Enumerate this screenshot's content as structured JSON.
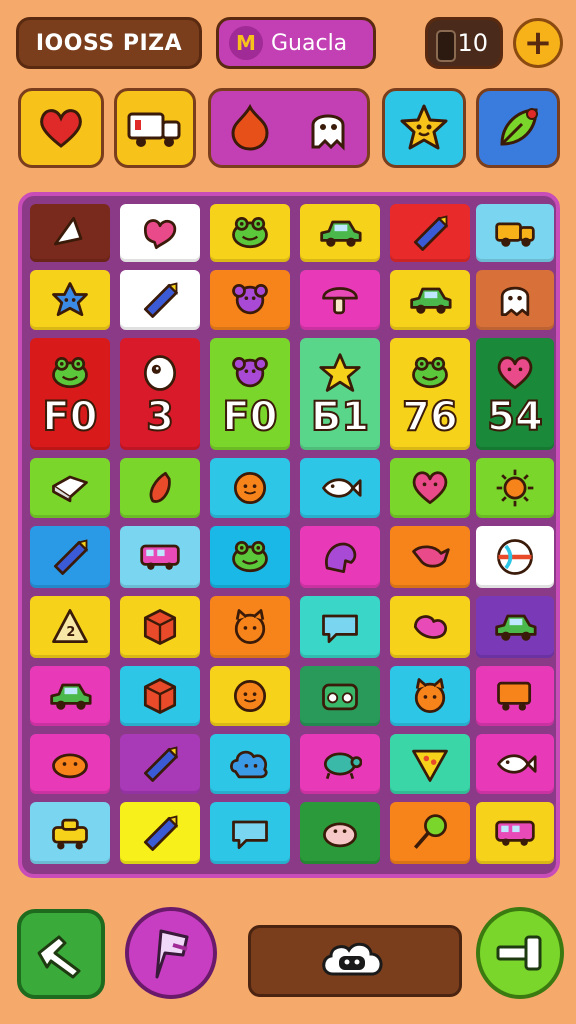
{
  "header": {
    "title": "IOOSS PIZA",
    "player_name": "Guacla",
    "player_badge_icon": "m-logo-icon",
    "count": "10",
    "plus_label": "+"
  },
  "powerups": [
    {
      "icon": "heart-icon",
      "color": "#f7c21a"
    },
    {
      "icon": "truck-icon",
      "color": "#f7c21a"
    },
    {
      "icon": "fire-ghost-icon",
      "color": "#c33fb4"
    },
    {
      "icon": "star-face-icon",
      "color": "#2ec6e6"
    },
    {
      "icon": "leaf-icon",
      "color": "#3a7bde"
    }
  ],
  "board": {
    "rows": [
      [
        {
          "color": "#7a2a1c",
          "icon": "pyramid-icon",
          "num": ""
        },
        {
          "color": "#ffffff",
          "icon": "heart-blob-icon",
          "num": ""
        },
        {
          "color": "#f7d21a",
          "icon": "frog-face-icon",
          "num": ""
        },
        {
          "color": "#f7d21a",
          "icon": "car-icon",
          "num": ""
        },
        {
          "color": "#e82a2a",
          "icon": "crayon-icon",
          "num": ""
        },
        {
          "color": "#7ad6f0",
          "icon": "truck-icon",
          "num": ""
        }
      ],
      [
        {
          "color": "#f7d21a",
          "icon": "star-blob-icon",
          "num": ""
        },
        {
          "color": "#ffffff",
          "icon": "crayon-icon",
          "num": ""
        },
        {
          "color": "#f7841a",
          "icon": "flower-icon",
          "num": ""
        },
        {
          "color": "#e83ab8",
          "icon": "mushroom-icon",
          "num": ""
        },
        {
          "color": "#f7d21a",
          "icon": "car-icon",
          "num": ""
        },
        {
          "color": "#d8703a",
          "icon": "ghost-icon",
          "num": ""
        }
      ],
      [
        {
          "color": "#d81a1a",
          "icon": "frog-face-icon",
          "num": "F0"
        },
        {
          "color": "#d81a2a",
          "icon": "ghost-face-icon",
          "num": "3"
        },
        {
          "color": "#7ad62a",
          "icon": "flower-icon",
          "num": "F0"
        },
        {
          "color": "#5ad68a",
          "icon": "star-icon",
          "num": "Б1"
        },
        {
          "color": "#f7d21a",
          "icon": "frog-face-icon",
          "num": "76"
        },
        {
          "color": "#1a8a3a",
          "icon": "heart-face-icon",
          "num": "54"
        }
      ],
      [
        {
          "color": "#7ad62a",
          "icon": "box-icon",
          "num": ""
        },
        {
          "color": "#7ad62a",
          "icon": "chili-icon",
          "num": ""
        },
        {
          "color": "#2ec6e6",
          "icon": "orange-face-icon",
          "num": ""
        },
        {
          "color": "#2ec6e6",
          "icon": "fish-icon",
          "num": ""
        },
        {
          "color": "#7ad62a",
          "icon": "heart-face-icon",
          "num": ""
        },
        {
          "color": "#7ad62a",
          "icon": "sun-icon",
          "num": ""
        }
      ],
      [
        {
          "color": "#2a9ae6",
          "icon": "crayon-icon",
          "num": ""
        },
        {
          "color": "#7ad6f0",
          "icon": "bus-icon",
          "num": ""
        },
        {
          "color": "#1ab8e6",
          "icon": "frog-face-icon",
          "num": ""
        },
        {
          "color": "#e83ab8",
          "icon": "creature-icon",
          "num": ""
        },
        {
          "color": "#f7841a",
          "icon": "bird-icon",
          "num": ""
        },
        {
          "color": "#ffffff",
          "icon": "ball-icon",
          "num": ""
        }
      ],
      [
        {
          "color": "#f7d21a",
          "icon": "triangle-two-icon",
          "num": ""
        },
        {
          "color": "#f7d21a",
          "icon": "cube-icon",
          "num": ""
        },
        {
          "color": "#f7841a",
          "icon": "cat-face-icon",
          "num": ""
        },
        {
          "color": "#3ad6c8",
          "icon": "speech-bubble-icon",
          "num": ""
        },
        {
          "color": "#f7d21a",
          "icon": "blob-icon",
          "num": ""
        },
        {
          "color": "#7a3ab8",
          "icon": "car-icon",
          "num": ""
        }
      ],
      [
        {
          "color": "#e83ab8",
          "icon": "car-icon",
          "num": ""
        },
        {
          "color": "#2ec6e6",
          "icon": "cube-icon",
          "num": ""
        },
        {
          "color": "#f7d21a",
          "icon": "orange-face-icon",
          "num": ""
        },
        {
          "color": "#2a9a5a",
          "icon": "radio-icon",
          "num": ""
        },
        {
          "color": "#2ec6e6",
          "icon": "cat-face-icon",
          "num": ""
        },
        {
          "color": "#e83ab8",
          "icon": "cart-icon",
          "num": ""
        }
      ],
      [
        {
          "color": "#e83ab8",
          "icon": "bean-face-icon",
          "num": ""
        },
        {
          "color": "#a83ab8",
          "icon": "crayon-icon",
          "num": ""
        },
        {
          "color": "#2ec6e6",
          "icon": "cloud-face-icon",
          "num": ""
        },
        {
          "color": "#e83ab8",
          "icon": "turtle-icon",
          "num": ""
        },
        {
          "color": "#3ad6a8",
          "icon": "pizza-icon",
          "num": ""
        },
        {
          "color": "#e83ab8",
          "icon": "fish-icon",
          "num": ""
        }
      ],
      [
        {
          "color": "#7ad6f0",
          "icon": "tank-icon",
          "num": ""
        },
        {
          "color": "#f7f01a",
          "icon": "crayon-icon",
          "num": ""
        },
        {
          "color": "#2ec6e6",
          "icon": "speech-bubble-icon",
          "num": ""
        },
        {
          "color": "#2a9a3a",
          "icon": "pig-icon",
          "num": ""
        },
        {
          "color": "#f7841a",
          "icon": "lollipop-icon",
          "num": ""
        },
        {
          "color": "#f7d21a",
          "icon": "bus-icon",
          "num": ""
        }
      ]
    ]
  },
  "footer": {
    "left_icon": "hand-pointer-icon",
    "circle_icon": "flag-icon",
    "bar_icon": "cloud-creature-icon",
    "right_icon": "hammer-icon"
  }
}
